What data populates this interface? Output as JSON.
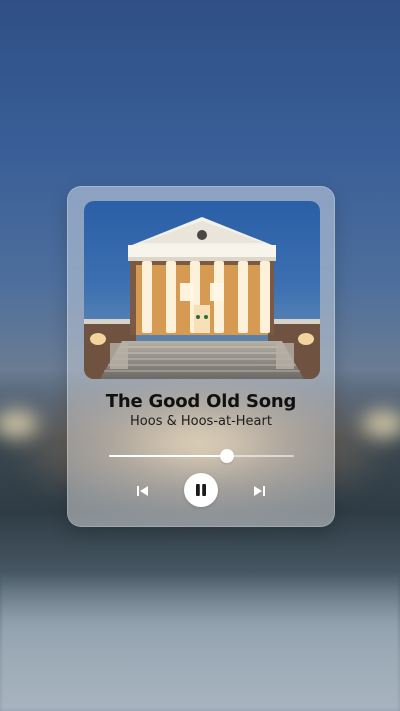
{
  "track": {
    "title": "The Good Old Song",
    "artist": "Hoos & Hoos-at-Heart",
    "progress_fraction": 0.64
  },
  "controls": {
    "previous_icon": "skip-previous-icon",
    "pause_icon": "pause-icon",
    "next_icon": "skip-next-icon"
  },
  "colors": {
    "accent": "#ffffff",
    "text": "#111111"
  }
}
